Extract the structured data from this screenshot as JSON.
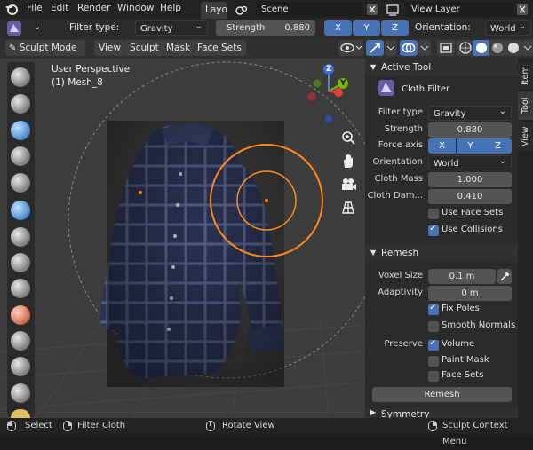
{
  "menubar": {
    "file": "File",
    "edit": "Edit",
    "render": "Render",
    "window": "Window",
    "help": "Help",
    "workspace_tab": "Layo",
    "scene": "Scene",
    "view_layer": "View Layer"
  },
  "tool_settings": {
    "filter_type_label": "Filter type:",
    "filter_type_value": "Gravity",
    "strength_label": "Strength",
    "strength_value": "0.880",
    "axis_x": "X",
    "axis_y": "Y",
    "axis_z": "Z",
    "orientation_label": "Orientation:",
    "orientation_value": "World"
  },
  "header": {
    "mode": "Sculpt Mode",
    "view": "View",
    "sculpt": "Sculpt",
    "mask": "Mask",
    "face_sets": "Face Sets"
  },
  "viewport": {
    "perspective": "User Perspective",
    "object": "(1) Mesh_8",
    "gizmo_z": "Z",
    "gizmo_y": "Y"
  },
  "panel": {
    "active_tool": {
      "title": "Active Tool",
      "tool_name": "Cloth Filter",
      "filter_type_label": "Filter type",
      "filter_type_value": "Gravity",
      "strength_label": "Strength",
      "strength_value": "0.880",
      "force_axis_label": "Force axis",
      "axis_x": "X",
      "axis_y": "Y",
      "axis_z": "Z",
      "orientation_label": "Orientation",
      "orientation_value": "World",
      "cloth_mass_label": "Cloth Mass",
      "cloth_mass_value": "1.000",
      "cloth_damping_label": "Cloth Dam...",
      "cloth_damping_value": "0.410",
      "use_face_sets": "Use Face Sets",
      "use_collisions": "Use Collisions"
    },
    "remesh": {
      "title": "Remesh",
      "voxel_size_label": "Voxel Size",
      "voxel_size_value": "0.1 m",
      "adaptivity_label": "Adaptivity",
      "adaptivity_value": "0 m",
      "fix_poles": "Fix Poles",
      "smooth_normals": "Smooth Normals",
      "preserve_label": "Preserve",
      "volume": "Volume",
      "paint_mask": "Paint Mask",
      "face_sets": "Face Sets",
      "remesh_button": "Remesh"
    },
    "symmetry": {
      "title": "Symmetry"
    },
    "side_tabs": {
      "item": "Item",
      "tool": "Tool",
      "view": "View"
    }
  },
  "statusbar": {
    "select": "Select",
    "filter_cloth": "Filter Cloth",
    "rotate_view": "Rotate View",
    "context_menu": "Sculpt Context Menu"
  },
  "colors": {
    "accent_blue": "#4772b3",
    "brush_ring": "#ff8a1a",
    "shirt_dark": "#2a3150"
  }
}
